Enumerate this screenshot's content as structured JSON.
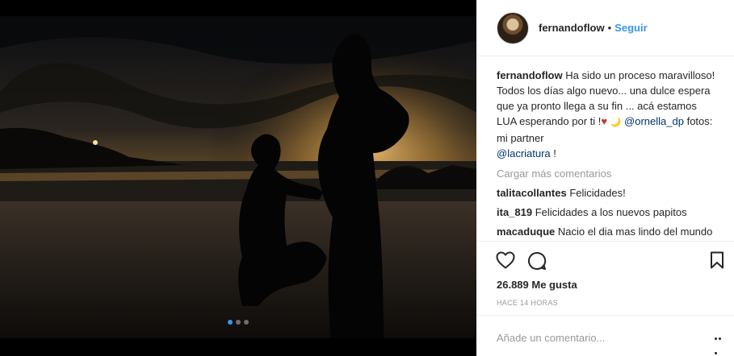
{
  "post": {
    "username": "fernandoflow",
    "separator": "•",
    "follow_label": "Seguir",
    "caption_text": "Ha sido un proceso maravilloso! Todos los días algo nuevo... una dulce espera que ya pronto llega a su fin ... acá estamos LUA esperando por ti !",
    "caption_heart": "♥",
    "caption_moon": "🌙",
    "mention_1": "@ornella_dp",
    "caption_credits": "fotos: mi partner",
    "mention_2": "@lacriatura",
    "caption_end": "!",
    "load_more_label": "Cargar más comentarios",
    "comments": [
      {
        "user": "talitacollantes",
        "text": "Felicidades!"
      },
      {
        "user": "ita_819",
        "text": "Felicidades a los nuevos papitos"
      },
      {
        "user": "macaduque",
        "text": "Nacio el dia mas lindo del mundo ♥"
      }
    ],
    "likes_label": "26.889 Me gusta",
    "time_label": "Hace 14 horas",
    "add_comment_placeholder": "Añade un comentario...",
    "carousel": {
      "count": 3,
      "active_index": 0
    }
  },
  "icons": [
    "heart-icon",
    "comment-icon",
    "bookmark-icon",
    "more-options-icon"
  ],
  "colors": {
    "accent": "#3897f0",
    "mention": "#003569",
    "muted": "#999999",
    "text": "#262626"
  }
}
